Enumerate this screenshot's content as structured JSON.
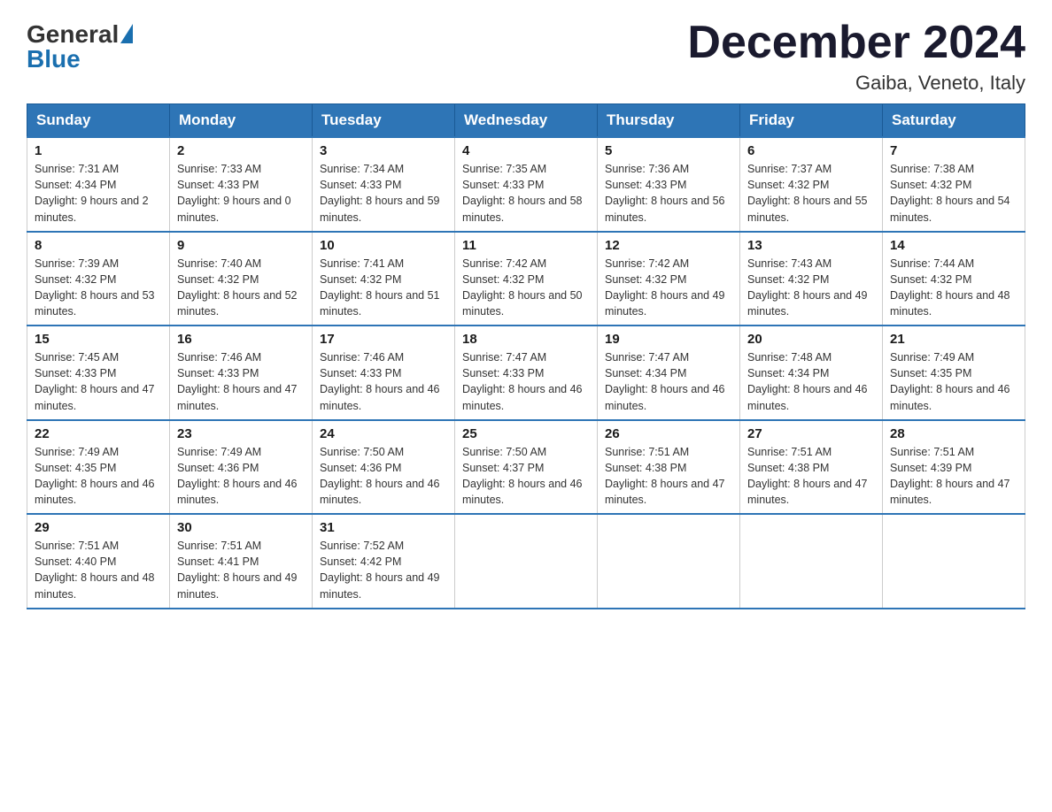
{
  "logo": {
    "general": "General",
    "blue": "Blue"
  },
  "title": "December 2024",
  "location": "Gaiba, Veneto, Italy",
  "days_of_week": [
    "Sunday",
    "Monday",
    "Tuesday",
    "Wednesday",
    "Thursday",
    "Friday",
    "Saturday"
  ],
  "weeks": [
    [
      {
        "day": "1",
        "sunrise": "7:31 AM",
        "sunset": "4:34 PM",
        "daylight": "9 hours and 2 minutes."
      },
      {
        "day": "2",
        "sunrise": "7:33 AM",
        "sunset": "4:33 PM",
        "daylight": "9 hours and 0 minutes."
      },
      {
        "day": "3",
        "sunrise": "7:34 AM",
        "sunset": "4:33 PM",
        "daylight": "8 hours and 59 minutes."
      },
      {
        "day": "4",
        "sunrise": "7:35 AM",
        "sunset": "4:33 PM",
        "daylight": "8 hours and 58 minutes."
      },
      {
        "day": "5",
        "sunrise": "7:36 AM",
        "sunset": "4:33 PM",
        "daylight": "8 hours and 56 minutes."
      },
      {
        "day": "6",
        "sunrise": "7:37 AM",
        "sunset": "4:32 PM",
        "daylight": "8 hours and 55 minutes."
      },
      {
        "day": "7",
        "sunrise": "7:38 AM",
        "sunset": "4:32 PM",
        "daylight": "8 hours and 54 minutes."
      }
    ],
    [
      {
        "day": "8",
        "sunrise": "7:39 AM",
        "sunset": "4:32 PM",
        "daylight": "8 hours and 53 minutes."
      },
      {
        "day": "9",
        "sunrise": "7:40 AM",
        "sunset": "4:32 PM",
        "daylight": "8 hours and 52 minutes."
      },
      {
        "day": "10",
        "sunrise": "7:41 AM",
        "sunset": "4:32 PM",
        "daylight": "8 hours and 51 minutes."
      },
      {
        "day": "11",
        "sunrise": "7:42 AM",
        "sunset": "4:32 PM",
        "daylight": "8 hours and 50 minutes."
      },
      {
        "day": "12",
        "sunrise": "7:42 AM",
        "sunset": "4:32 PM",
        "daylight": "8 hours and 49 minutes."
      },
      {
        "day": "13",
        "sunrise": "7:43 AM",
        "sunset": "4:32 PM",
        "daylight": "8 hours and 49 minutes."
      },
      {
        "day": "14",
        "sunrise": "7:44 AM",
        "sunset": "4:32 PM",
        "daylight": "8 hours and 48 minutes."
      }
    ],
    [
      {
        "day": "15",
        "sunrise": "7:45 AM",
        "sunset": "4:33 PM",
        "daylight": "8 hours and 47 minutes."
      },
      {
        "day": "16",
        "sunrise": "7:46 AM",
        "sunset": "4:33 PM",
        "daylight": "8 hours and 47 minutes."
      },
      {
        "day": "17",
        "sunrise": "7:46 AM",
        "sunset": "4:33 PM",
        "daylight": "8 hours and 46 minutes."
      },
      {
        "day": "18",
        "sunrise": "7:47 AM",
        "sunset": "4:33 PM",
        "daylight": "8 hours and 46 minutes."
      },
      {
        "day": "19",
        "sunrise": "7:47 AM",
        "sunset": "4:34 PM",
        "daylight": "8 hours and 46 minutes."
      },
      {
        "day": "20",
        "sunrise": "7:48 AM",
        "sunset": "4:34 PM",
        "daylight": "8 hours and 46 minutes."
      },
      {
        "day": "21",
        "sunrise": "7:49 AM",
        "sunset": "4:35 PM",
        "daylight": "8 hours and 46 minutes."
      }
    ],
    [
      {
        "day": "22",
        "sunrise": "7:49 AM",
        "sunset": "4:35 PM",
        "daylight": "8 hours and 46 minutes."
      },
      {
        "day": "23",
        "sunrise": "7:49 AM",
        "sunset": "4:36 PM",
        "daylight": "8 hours and 46 minutes."
      },
      {
        "day": "24",
        "sunrise": "7:50 AM",
        "sunset": "4:36 PM",
        "daylight": "8 hours and 46 minutes."
      },
      {
        "day": "25",
        "sunrise": "7:50 AM",
        "sunset": "4:37 PM",
        "daylight": "8 hours and 46 minutes."
      },
      {
        "day": "26",
        "sunrise": "7:51 AM",
        "sunset": "4:38 PM",
        "daylight": "8 hours and 47 minutes."
      },
      {
        "day": "27",
        "sunrise": "7:51 AM",
        "sunset": "4:38 PM",
        "daylight": "8 hours and 47 minutes."
      },
      {
        "day": "28",
        "sunrise": "7:51 AM",
        "sunset": "4:39 PM",
        "daylight": "8 hours and 47 minutes."
      }
    ],
    [
      {
        "day": "29",
        "sunrise": "7:51 AM",
        "sunset": "4:40 PM",
        "daylight": "8 hours and 48 minutes."
      },
      {
        "day": "30",
        "sunrise": "7:51 AM",
        "sunset": "4:41 PM",
        "daylight": "8 hours and 49 minutes."
      },
      {
        "day": "31",
        "sunrise": "7:52 AM",
        "sunset": "4:42 PM",
        "daylight": "8 hours and 49 minutes."
      },
      null,
      null,
      null,
      null
    ]
  ]
}
